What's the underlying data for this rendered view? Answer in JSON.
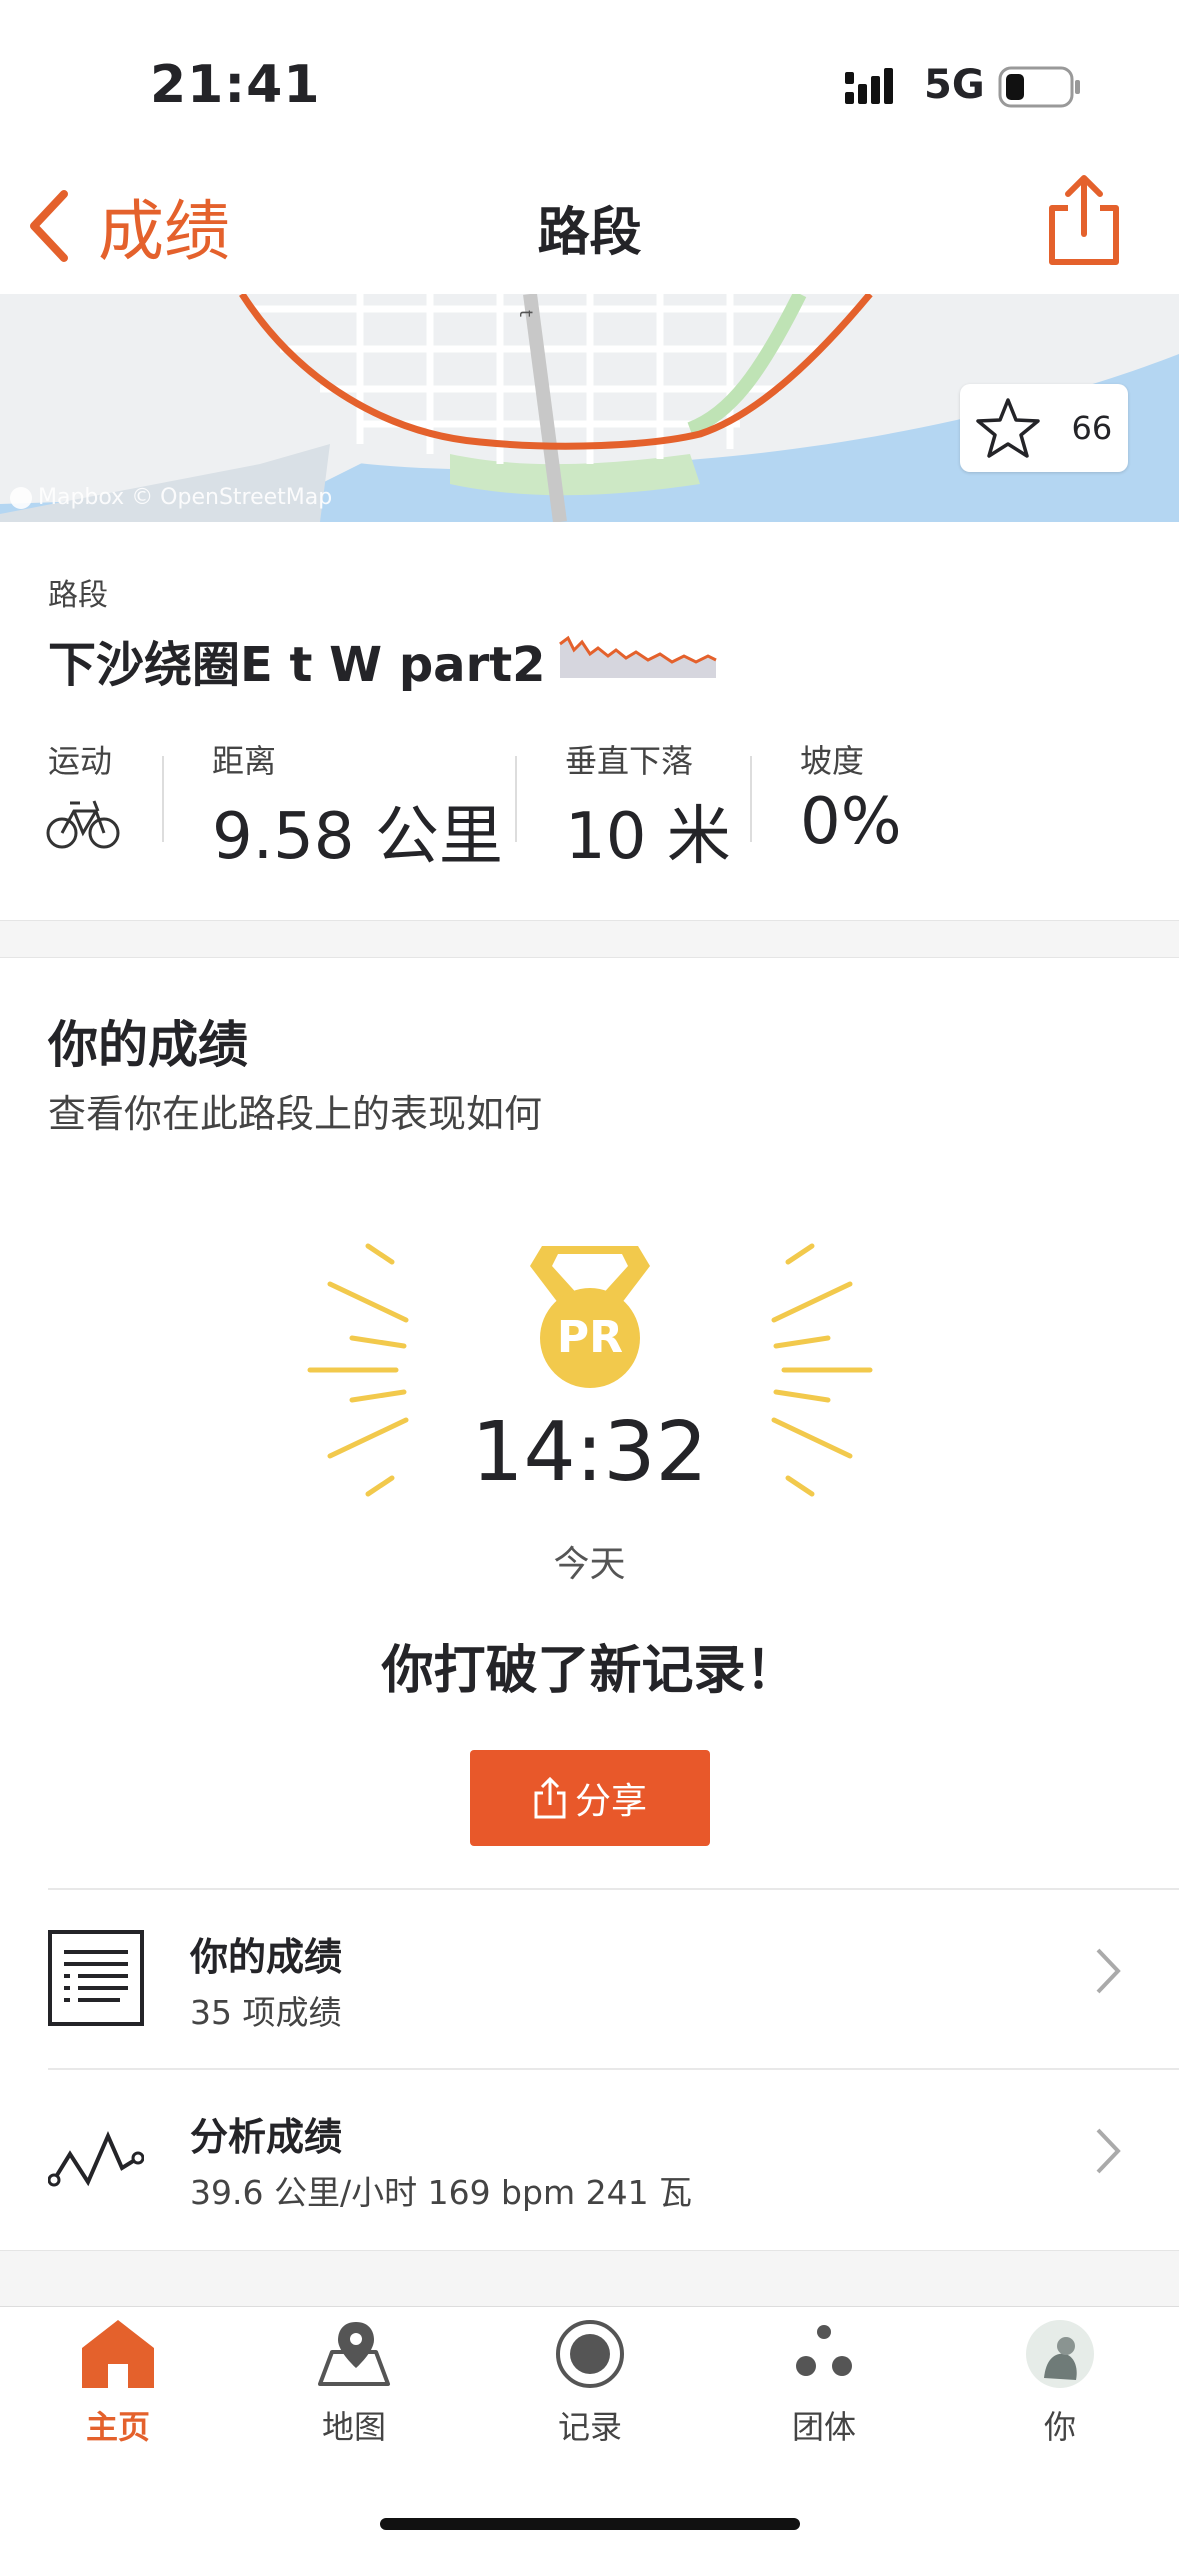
{
  "status_bar": {
    "time": "21:41",
    "network": "5G"
  },
  "nav": {
    "back_label": "成绩",
    "title": "路段"
  },
  "map": {
    "star_count": "66",
    "credit": "Mapbox © OpenStreetMap"
  },
  "segment": {
    "label": "路段",
    "name": "下沙绕圈E t W part2",
    "stats": {
      "sport_label": "运动",
      "distance_label": "距离",
      "distance_value": "9.58 公里",
      "drop_label": "垂直下落",
      "drop_value": "10 米",
      "grade_label": "坡度",
      "grade_value": "0%"
    }
  },
  "performance": {
    "title": "你的成绩",
    "subtitle": "查看你在此路段上的表现如何",
    "pr_badge": "PR",
    "pr_time": "14:32",
    "pr_date": "今天",
    "message": "你打破了新记录！",
    "share_label": "分享"
  },
  "rows": [
    {
      "title": "你的成绩",
      "subtitle": "35 项成绩"
    },
    {
      "title": "分析成绩",
      "subtitle": "39.6 公里/小时 169 bpm 241 瓦"
    }
  ],
  "tabs": [
    {
      "label": "主页"
    },
    {
      "label": "地图"
    },
    {
      "label": "记录"
    },
    {
      "label": "团体"
    },
    {
      "label": "你"
    }
  ],
  "colors": {
    "accent": "#E4612C",
    "pr_gold": "#F2C94C",
    "water": "#B4D6F2"
  }
}
